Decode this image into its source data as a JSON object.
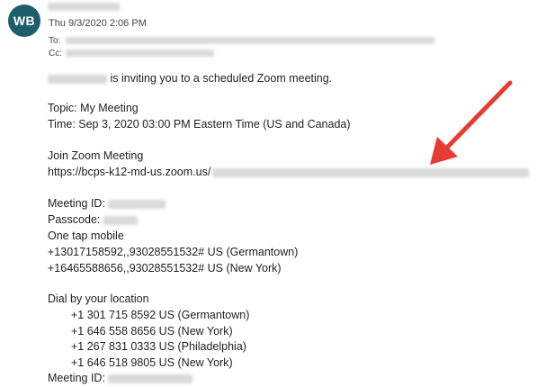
{
  "email": {
    "avatar_initials": "WB",
    "date": "Thu 9/3/2020 2:06 PM",
    "to_label": "To:",
    "cc_label": "Cc:",
    "invite_text": "is inviting you to a scheduled Zoom meeting.",
    "topic": "Topic: My Meeting",
    "time": "Time: Sep 3, 2020 03:00 PM Eastern Time (US and Canada)",
    "join_heading": "Join Zoom Meeting",
    "join_url_prefix": "https://bcps-k12-md-us.zoom.us/",
    "meeting_id_label": "Meeting ID:",
    "passcode_label": "Passcode:",
    "one_tap_heading": "One tap mobile",
    "one_tap": [
      "+13017158592,,93028551532# US (Germantown)",
      "+16465588656,,93028551532# US (New York)"
    ],
    "dial_heading": "Dial by your location",
    "dial_numbers": [
      "+1 301 715 8592 US (Germantown)",
      "+1 646 558 8656 US (New York)",
      "+1 267 831 0333 US (Philadelphia)",
      "+1 646 518 9805 US (New York)"
    ],
    "meeting_id_label_2": "Meeting ID:"
  },
  "colors": {
    "avatar": "#1b5f6a",
    "annotation_arrow": "#e53b33"
  }
}
